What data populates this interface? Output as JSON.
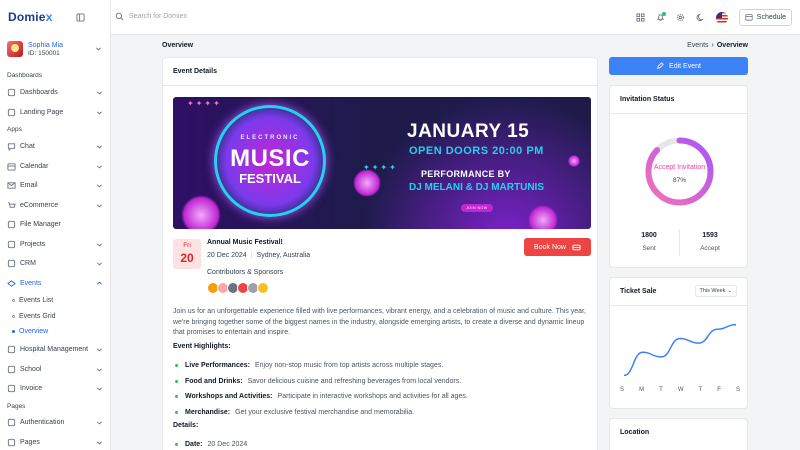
{
  "app": {
    "logo_main": "Domie",
    "logo_accent": "x"
  },
  "user": {
    "name": "Sophia Mia",
    "id": "ID: 150001"
  },
  "sidebar": {
    "section_dashboards": "Dashboards",
    "section_apps": "Apps",
    "section_pages": "Pages",
    "items_top": [
      {
        "label": "Dashboards",
        "icon": "dashboard-icon"
      },
      {
        "label": "Landing Page",
        "icon": "landing-page-icon"
      }
    ],
    "items_apps": [
      {
        "label": "Chat",
        "icon": "chat-icon"
      },
      {
        "label": "Calendar",
        "icon": "calendar-icon"
      },
      {
        "label": "Email",
        "icon": "email-icon"
      },
      {
        "label": "eCommerce",
        "icon": "cart-icon"
      },
      {
        "label": "File Manager",
        "icon": "file-icon"
      },
      {
        "label": "Projects",
        "icon": "projects-icon"
      },
      {
        "label": "CRM",
        "icon": "crm-icon"
      },
      {
        "label": "Events",
        "icon": "events-icon"
      }
    ],
    "events_sub": [
      {
        "label": "Events List"
      },
      {
        "label": "Events Grid"
      },
      {
        "label": "Overview"
      }
    ],
    "items_after": [
      {
        "label": "Hospital Management",
        "icon": "hospital-icon"
      },
      {
        "label": "School",
        "icon": "school-icon"
      },
      {
        "label": "Invoice",
        "icon": "invoice-icon"
      }
    ],
    "items_pages": [
      {
        "label": "Authentication",
        "icon": "auth-icon"
      },
      {
        "label": "Pages",
        "icon": "pages-icon"
      }
    ]
  },
  "topbar": {
    "search_placeholder": "Search for Domiex",
    "schedule_label": "Schedule"
  },
  "breadcrumb": {
    "title": "Overview",
    "parent": "Events",
    "current": "Overview"
  },
  "event": {
    "card_title": "Event Details",
    "banner": {
      "electronic": "ELECTRONIC",
      "music": "MUSIC",
      "festival": "FESTIVAL",
      "date": "JANUARY 15",
      "doors": "OPEN  DOORS 20:00  PM",
      "performance": "PERFORMANCE BY",
      "artists": "DJ MELANI & DJ MARTUNIS",
      "join": "JOIN NOW"
    },
    "day_of_week": "Fri",
    "day": "20",
    "title": "Annual Music Festival!",
    "date": "20 Dec 2024",
    "location": "Sydney, Australia",
    "book_label": "Book Now",
    "contributors_label": "Contributors & Sponsors",
    "contributor_colors": [
      "#f59e0b",
      "#fca5a5",
      "#6b7280",
      "#ef4444",
      "#9ca3af",
      "#fbbf24"
    ],
    "description": "Join us for an unforgettable experience filled with live performances, vibrant energy, and a celebration of music and culture. This year, we're bringing together some of the biggest names in the industry, alongside emerging artists, to create a diverse and dynamic lineup that promises to entertain and inspire.",
    "highlights_title": "Event Highlights:",
    "highlights": [
      {
        "title": "Live Performances:",
        "text": "Enjoy non-stop music from top artists across multiple stages."
      },
      {
        "title": "Food and Drinks:",
        "text": "Savor delicious cuisine and refreshing beverages from local vendors."
      },
      {
        "title": "Workshops and Activities:",
        "text": "Participate in interactive workshops and activities for all ages."
      },
      {
        "title": "Merchandise:",
        "text": "Get your exclusive festival merchandise and memorabilia."
      }
    ],
    "details_title": "Details:",
    "details": [
      {
        "title": "Date:",
        "text": "20 Dec 2024"
      }
    ]
  },
  "right": {
    "edit_label": "Edit Event",
    "invitation": {
      "title": "Invitation Status",
      "center_label": "Accept Invitation",
      "percent_label": "87%",
      "percent": 87,
      "sent_value": "1800",
      "sent_label": "Sent",
      "accept_value": "1593",
      "accept_label": "Accept"
    },
    "ticket": {
      "title": "Ticket Sale",
      "range": "This Week",
      "days": [
        "S",
        "M",
        "T",
        "W",
        "T",
        "F",
        "S"
      ]
    },
    "location": {
      "title": "Location"
    }
  },
  "colors": {
    "accent": "#3b82f6",
    "danger": "#ef4444",
    "pink": "#ec4899",
    "bullet": "#22c55e"
  },
  "chart_data": {
    "type": "line",
    "x": [
      "S",
      "M",
      "T",
      "W",
      "T",
      "F",
      "S"
    ],
    "series": [
      {
        "values": [
          5,
          30,
          25,
          45,
          40,
          55,
          60
        ]
      }
    ]
  }
}
